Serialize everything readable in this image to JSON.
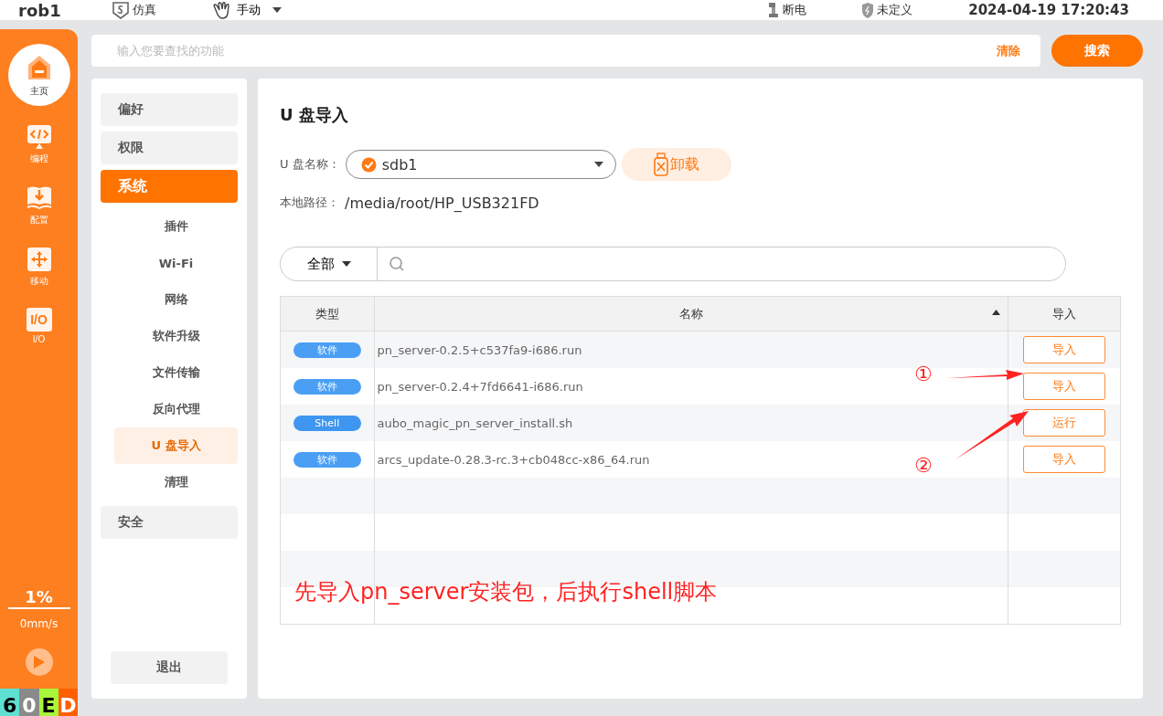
{
  "top_bar": {
    "robot": "rob1",
    "mode": "仿真",
    "control": "手动",
    "power": "断电",
    "safety": "未定义",
    "datetime": "2024-04-19 17:20:43"
  },
  "nav": [
    {
      "label": "主页",
      "kind": "home",
      "selected": true
    },
    {
      "label": "编程",
      "kind": "code",
      "selected": false
    },
    {
      "label": "配置",
      "kind": "download",
      "selected": false
    },
    {
      "label": "移动",
      "kind": "move",
      "selected": false
    },
    {
      "label": "I/O",
      "kind": "io",
      "badge": "I/O",
      "selected": false
    }
  ],
  "speed": {
    "percent": "1%",
    "velocity": "0mm/s"
  },
  "status_blocks": [
    {
      "label": "6",
      "color": "#5fe0d0"
    },
    {
      "label": "0",
      "color": "#8a8a8a"
    },
    {
      "label": "E",
      "color": "#a9f53a"
    },
    {
      "label": "D",
      "color": "#ff5f00"
    }
  ],
  "search": {
    "placeholder": "输入您要查找的功能",
    "clear": "清除",
    "button": "搜索"
  },
  "menu": [
    {
      "label": "偏好",
      "selected": false
    },
    {
      "label": "权限",
      "selected": false
    },
    {
      "label": "系统",
      "selected": true,
      "children": [
        {
          "label": "插件",
          "selected": false
        },
        {
          "label": "Wi-Fi",
          "selected": false
        },
        {
          "label": "网络",
          "selected": false
        },
        {
          "label": "软件升级",
          "selected": false
        },
        {
          "label": "文件传输",
          "selected": false
        },
        {
          "label": "反向代理",
          "selected": false
        },
        {
          "label": "U 盘导入",
          "selected": true
        },
        {
          "label": "清理",
          "selected": false
        }
      ]
    },
    {
      "label": "安全",
      "selected": false
    }
  ],
  "exit_button": "退出",
  "page": {
    "title": "U 盘导入",
    "drive_label": "U 盘名称：",
    "drive": "sdb1",
    "unmount": "卸载",
    "path_label": "本地路径：",
    "path": "/media/root/HP_USB321FD",
    "filter": "全部"
  },
  "table": {
    "columns": [
      {
        "label": "类型"
      },
      {
        "label": "名称",
        "sorted": true
      },
      {
        "label": "导入"
      }
    ],
    "rows": [
      {
        "type": "软件",
        "kind": "software",
        "name": "pn_server-0.2.5+c537fa9-i686.run",
        "action": "导入"
      },
      {
        "type": "软件",
        "kind": "software",
        "name": "pn_server-0.2.4+7fd6641-i686.run",
        "action": "导入"
      },
      {
        "type": "Shell",
        "kind": "shell",
        "name": "aubo_magic_pn_server_install.sh",
        "action": "运行"
      },
      {
        "type": "软件",
        "kind": "software",
        "name": "arcs_update-0.28.3-rc.3+cb048cc-x86_64.run",
        "action": "导入"
      }
    ]
  },
  "annotations": {
    "marks": [
      "①",
      "②"
    ],
    "note": "先导入pn_server安装包，后执行shell脚本"
  }
}
